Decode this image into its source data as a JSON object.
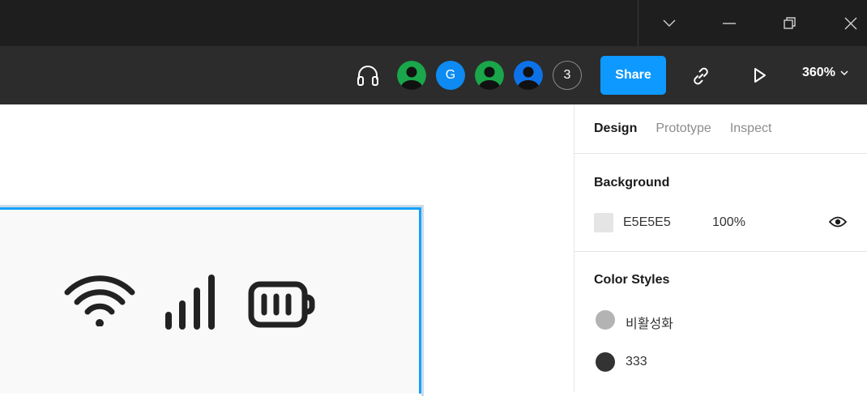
{
  "toolbar": {
    "avatars": [
      {
        "kind": "person",
        "color": "#1aa64a"
      },
      {
        "kind": "letter",
        "letter": "G",
        "color": "#0d8bf2"
      },
      {
        "kind": "person",
        "color": "#1aa64a"
      },
      {
        "kind": "person",
        "color": "#0d72e8"
      }
    ],
    "extra_count": "3",
    "share_label": "Share",
    "zoom_label": "360%",
    "accent": "#0d99ff"
  },
  "panel": {
    "tabs": [
      {
        "label": "Design",
        "active": true
      },
      {
        "label": "Prototype",
        "active": false
      },
      {
        "label": "Inspect",
        "active": false
      }
    ],
    "background": {
      "title": "Background",
      "hex": "E5E5E5",
      "opacity": "100%",
      "swatch_color": "#e5e5e5"
    },
    "color_styles": {
      "title": "Color Styles",
      "items": [
        {
          "name": "비활성화",
          "color": "#b3b3b3"
        },
        {
          "name": "333",
          "color": "#333333"
        }
      ]
    }
  },
  "canvas": {
    "frame_bg": "#f9f9f9",
    "selection_color": "#18a0fb",
    "status_icons": [
      "wifi-icon",
      "signal-bars-icon",
      "battery-icon"
    ]
  }
}
